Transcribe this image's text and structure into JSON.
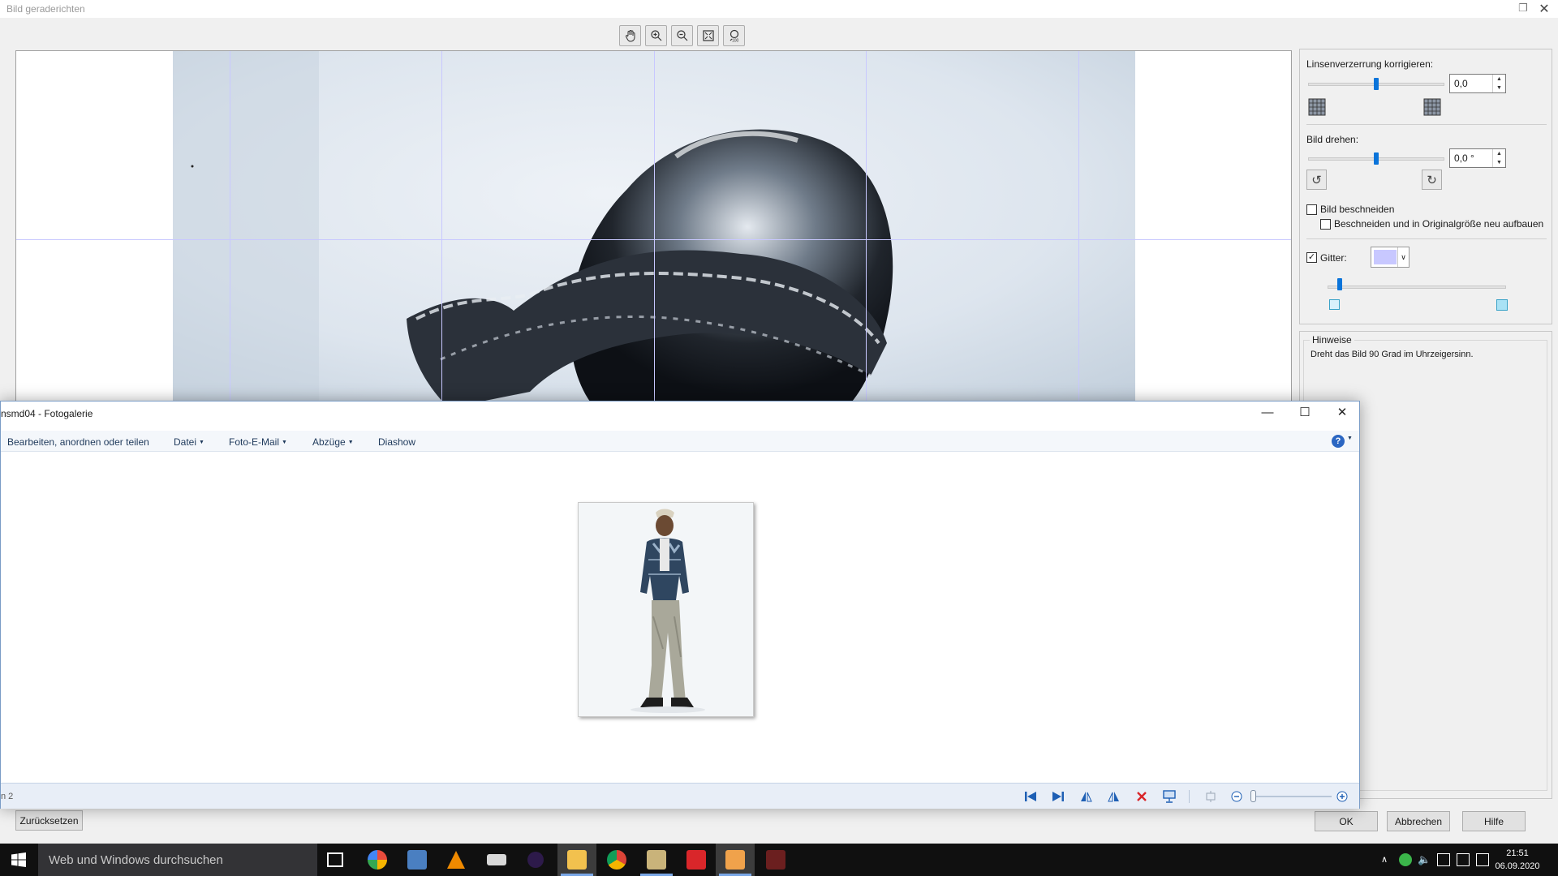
{
  "straighten_dialog": {
    "title": "Bild geraderichten",
    "lens": {
      "label": "Linsenverzerrung korrigieren:",
      "value": "0,0",
      "slider_level": 0.5
    },
    "rotate": {
      "label": "Bild drehen:",
      "value": "0,0 °",
      "slider_level": 0.5
    },
    "crop": {
      "label": "Bild beschneiden",
      "checked": false
    },
    "crop_rebuild": {
      "label": "Beschneiden und in Originalgröße neu aufbauen",
      "checked": false
    },
    "grid": {
      "label": "Gitter:",
      "checked": true,
      "color": "#c8c8ff",
      "size_level": 0.07
    },
    "hints": {
      "title": "Hinweise",
      "text": "Dreht das Bild 90 Grad im Uhrzeigersinn."
    },
    "buttons": {
      "reset": "Zurücksetzen",
      "ok": "OK",
      "cancel": "Abbrechen",
      "help": "Hilfe"
    }
  },
  "gallery": {
    "title": "nsmd04 - Fotogalerie",
    "menu": {
      "edit": "Bearbeiten, anordnen oder teilen",
      "file": "Datei",
      "email": "Foto-E-Mail",
      "prints": "Abzüge",
      "slideshow": "Diashow",
      "help": "?"
    },
    "status": "n 2",
    "zoom_level": 0.0
  },
  "taskbar": {
    "search_placeholder": "Web und Windows durchsuchen",
    "time": "21:51",
    "date": "06.09.2020"
  },
  "colors": {
    "accent": "#0a74da",
    "grid_line": "#c8c8ff",
    "taskbar": "#101010"
  }
}
